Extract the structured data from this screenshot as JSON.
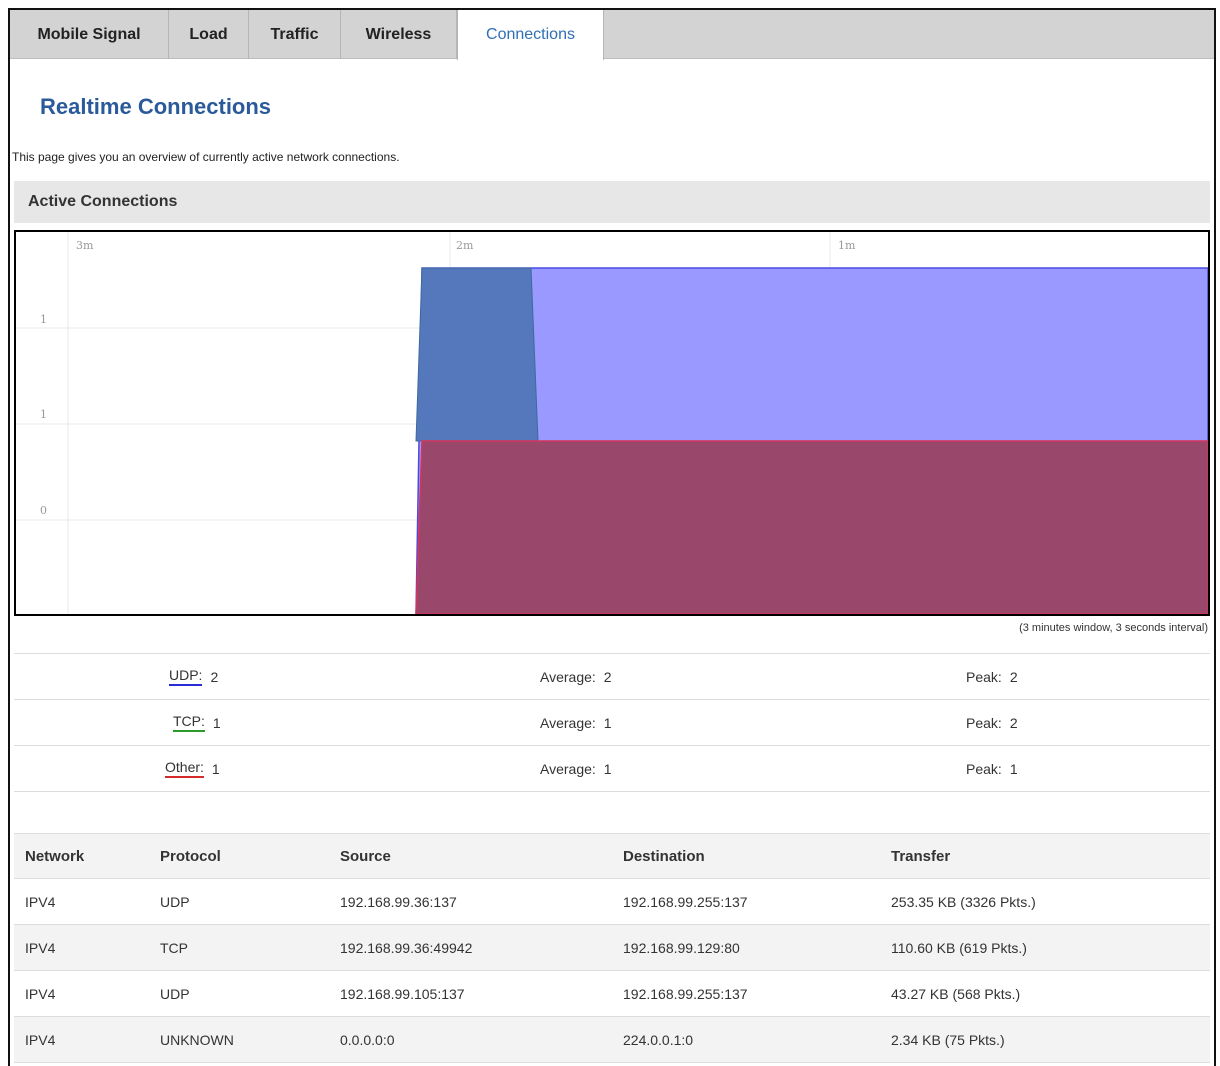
{
  "tabs": [
    {
      "label": "Mobile Signal"
    },
    {
      "label": "Load"
    },
    {
      "label": "Traffic"
    },
    {
      "label": "Wireless"
    },
    {
      "label": "Connections"
    }
  ],
  "page": {
    "title": "Realtime Connections",
    "intro": "This page gives you an overview of currently active network connections."
  },
  "section": {
    "title": "Active Connections"
  },
  "chart_data": {
    "type": "area",
    "x_ticks": [
      "3m",
      "2m",
      "1m"
    ],
    "y_ticks": [
      "1",
      "1",
      "0"
    ],
    "series": [
      {
        "name": "UDP",
        "color": "#2b2bd6",
        "values": [
          {
            "t": "3m",
            "v": null
          },
          {
            "t": "2m",
            "v": 2
          },
          {
            "t": "1m",
            "v": 2
          },
          {
            "t": "now",
            "v": 2
          }
        ]
      },
      {
        "name": "TCP",
        "color": "#2a9a2a",
        "values": [
          {
            "t": "2m",
            "v": 2
          },
          {
            "t": "1m",
            "v": 1
          },
          {
            "t": "now",
            "v": 1
          }
        ]
      },
      {
        "name": "Other",
        "color": "#d62b2b",
        "values": [
          {
            "t": "2m",
            "v": 1
          },
          {
            "t": "1m",
            "v": 1
          },
          {
            "t": "now",
            "v": 1
          }
        ]
      }
    ]
  },
  "window_note": "(3 minutes window, 3 seconds interval)",
  "stats": [
    {
      "label": "UDP:",
      "value": "2",
      "avg_label": "Average:",
      "avg": "2",
      "peak_label": "Peak:",
      "peak": "2"
    },
    {
      "label": "TCP:",
      "value": "1",
      "avg_label": "Average:",
      "avg": "1",
      "peak_label": "Peak:",
      "peak": "2"
    },
    {
      "label": "Other:",
      "value": "1",
      "avg_label": "Average:",
      "avg": "1",
      "peak_label": "Peak:",
      "peak": "1"
    }
  ],
  "table": {
    "headers": [
      "Network",
      "Protocol",
      "Source",
      "Destination",
      "Transfer"
    ],
    "rows": [
      [
        "IPV4",
        "UDP",
        "192.168.99.36:137",
        "192.168.99.255:137",
        "253.35 KB (3326 Pkts.)"
      ],
      [
        "IPV4",
        "TCP",
        "192.168.99.36:49942",
        "192.168.99.129:80",
        "110.60 KB (619 Pkts.)"
      ],
      [
        "IPV4",
        "UDP",
        "192.168.99.105:137",
        "192.168.99.255:137",
        "43.27 KB (568 Pkts.)"
      ],
      [
        "IPV4",
        "UNKNOWN",
        "0.0.0.0:0",
        "224.0.0.1:0",
        "2.34 KB (75 Pkts.)"
      ]
    ]
  }
}
